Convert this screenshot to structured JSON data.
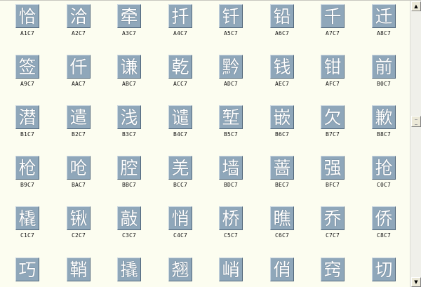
{
  "accent": "#8fa7ba",
  "background": "#fcfdf0",
  "glyphs": [
    {
      "char": "恰",
      "code": "A1C7"
    },
    {
      "char": "洽",
      "code": "A2C7"
    },
    {
      "char": "牵",
      "code": "A3C7"
    },
    {
      "char": "扦",
      "code": "A4C7"
    },
    {
      "char": "钎",
      "code": "A5C7"
    },
    {
      "char": "铅",
      "code": "A6C7"
    },
    {
      "char": "千",
      "code": "A7C7"
    },
    {
      "char": "迁",
      "code": "A8C7"
    },
    {
      "char": "签",
      "code": "A9C7"
    },
    {
      "char": "仟",
      "code": "AAC7"
    },
    {
      "char": "谦",
      "code": "ABC7"
    },
    {
      "char": "乾",
      "code": "ACC7"
    },
    {
      "char": "黔",
      "code": "ADC7"
    },
    {
      "char": "钱",
      "code": "AEC7"
    },
    {
      "char": "钳",
      "code": "AFC7"
    },
    {
      "char": "前",
      "code": "B0C7"
    },
    {
      "char": "潜",
      "code": "B1C7"
    },
    {
      "char": "遣",
      "code": "B2C7"
    },
    {
      "char": "浅",
      "code": "B3C7"
    },
    {
      "char": "谴",
      "code": "B4C7"
    },
    {
      "char": "堑",
      "code": "B5C7"
    },
    {
      "char": "嵌",
      "code": "B6C7"
    },
    {
      "char": "欠",
      "code": "B7C7"
    },
    {
      "char": "歉",
      "code": "B8C7"
    },
    {
      "char": "枪",
      "code": "B9C7"
    },
    {
      "char": "呛",
      "code": "BAC7"
    },
    {
      "char": "腔",
      "code": "BBC7"
    },
    {
      "char": "羌",
      "code": "BCC7"
    },
    {
      "char": "墙",
      "code": "BDC7"
    },
    {
      "char": "蔷",
      "code": "BEC7"
    },
    {
      "char": "强",
      "code": "BFC7"
    },
    {
      "char": "抢",
      "code": "C0C7"
    },
    {
      "char": "橇",
      "code": "C1C7"
    },
    {
      "char": "锹",
      "code": "C2C7"
    },
    {
      "char": "敲",
      "code": "C3C7"
    },
    {
      "char": "悄",
      "code": "C4C7"
    },
    {
      "char": "桥",
      "code": "C5C7"
    },
    {
      "char": "瞧",
      "code": "C6C7"
    },
    {
      "char": "乔",
      "code": "C7C7"
    },
    {
      "char": "侨",
      "code": "C8C7"
    },
    {
      "char": "巧",
      "code": ""
    },
    {
      "char": "鞘",
      "code": ""
    },
    {
      "char": "撬",
      "code": ""
    },
    {
      "char": "翘",
      "code": ""
    },
    {
      "char": "峭",
      "code": ""
    },
    {
      "char": "俏",
      "code": ""
    },
    {
      "char": "窍",
      "code": ""
    },
    {
      "char": "切",
      "code": ""
    }
  ],
  "scrollbar": {
    "up_icon": "▲",
    "down_icon": "▼",
    "position_fraction": 0.41
  }
}
